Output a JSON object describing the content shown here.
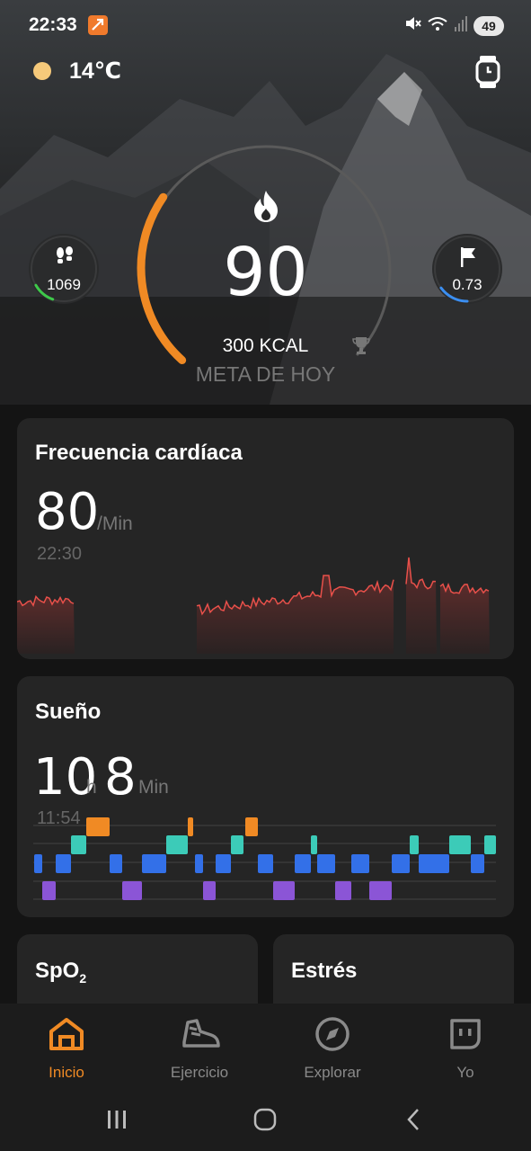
{
  "status_bar": {
    "time": "22:33",
    "battery": "49",
    "icons": [
      "app-notification-icon",
      "mute-icon",
      "wifi-icon",
      "signal-icon"
    ]
  },
  "weather": {
    "temperature": "14℃",
    "icon": "sun-icon"
  },
  "calories": {
    "value": "90",
    "goal": "300 KCAL",
    "label": "META DE HOY",
    "progress": 0.3,
    "accent": "#f08a24"
  },
  "steps": {
    "value": "1069",
    "progress": 0.2,
    "ring_color": "#3ec94a",
    "icon": "footprints-icon"
  },
  "distance_goal": {
    "value": "0.73",
    "progress": 0.25,
    "ring_color": "#3b8ef0",
    "icon": "flag-icon"
  },
  "heart_rate": {
    "title": "Frecuencia cardíaca",
    "value": "80",
    "unit": "/Min",
    "time": "22:30",
    "line_color": "#e8504a"
  },
  "sleep": {
    "title": "Sueño",
    "hours": "10",
    "hours_unit": "h",
    "minutes": "8",
    "minutes_unit": "Min",
    "time": "11:54",
    "stage_colors": {
      "awake": "#f08a24",
      "rem": "#3ccbb8",
      "light": "#3370e8",
      "deep": "#8b55d6"
    }
  },
  "spo2": {
    "title": "SpO",
    "subscript": "2"
  },
  "stress": {
    "title": "Estrés"
  },
  "bottom_nav": {
    "items": [
      {
        "label": "Inicio",
        "icon": "home-icon",
        "active": true
      },
      {
        "label": "Ejercicio",
        "icon": "shoe-icon",
        "active": false
      },
      {
        "label": "Explorar",
        "icon": "compass-icon",
        "active": false
      },
      {
        "label": "Yo",
        "icon": "profile-icon",
        "active": false
      }
    ]
  }
}
